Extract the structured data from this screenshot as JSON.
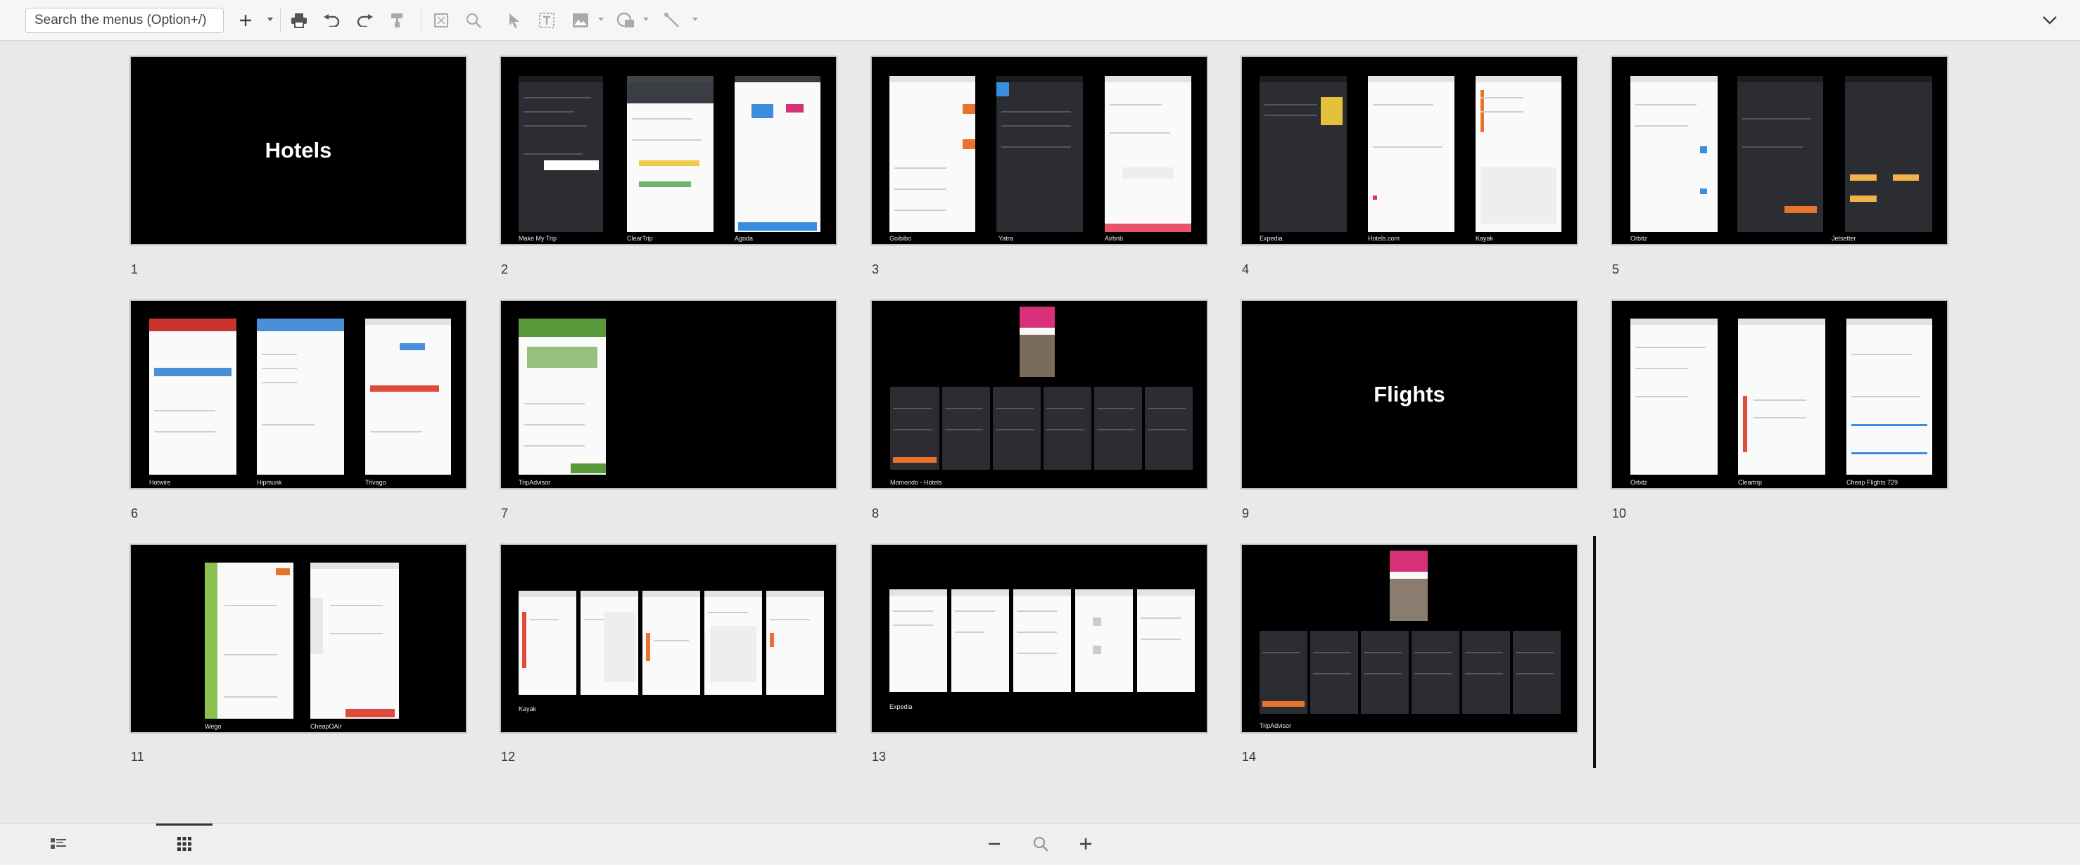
{
  "toolbar": {
    "search_placeholder": "Search the menus (Option+/)"
  },
  "slides": [
    {
      "number": "1",
      "title": "Hotels",
      "captions": []
    },
    {
      "number": "2",
      "title": "",
      "captions": [
        "Make My Trip",
        "ClearTrip",
        "Agoda"
      ]
    },
    {
      "number": "3",
      "title": "",
      "captions": [
        "Goibibo",
        "Yatra",
        "Airbnb"
      ]
    },
    {
      "number": "4",
      "title": "",
      "captions": [
        "Expedia",
        "Hotels.com",
        "Kayak"
      ]
    },
    {
      "number": "5",
      "title": "",
      "captions": [
        "Orbitz",
        "Jetsetter"
      ]
    },
    {
      "number": "6",
      "title": "",
      "captions": [
        "Hotwire",
        "Hipmunk",
        "Trivago"
      ]
    },
    {
      "number": "7",
      "title": "",
      "captions": [
        "TripAdvisor"
      ]
    },
    {
      "number": "8",
      "title": "",
      "captions": [
        "Momondo - Hotels"
      ]
    },
    {
      "number": "9",
      "title": "Flights",
      "captions": []
    },
    {
      "number": "10",
      "title": "",
      "captions": [
        "Orbitz",
        "Cleartrip",
        "Cheap Flights 729"
      ]
    },
    {
      "number": "11",
      "title": "",
      "captions": [
        "Wego",
        "CheapOAir"
      ]
    },
    {
      "number": "12",
      "title": "",
      "captions": [
        "Kayak"
      ]
    },
    {
      "number": "13",
      "title": "",
      "captions": [
        "Expedia"
      ]
    },
    {
      "number": "14",
      "title": "",
      "captions": [
        "TripAdvisor"
      ]
    }
  ],
  "colors": {
    "slide_bg": "#000000",
    "canvas_bg": "#e9e9e9",
    "accent_orange": "#e8742c",
    "accent_blue": "#3b8de0",
    "accent_green": "#5a9a3c",
    "accent_pink": "#d9307a"
  }
}
